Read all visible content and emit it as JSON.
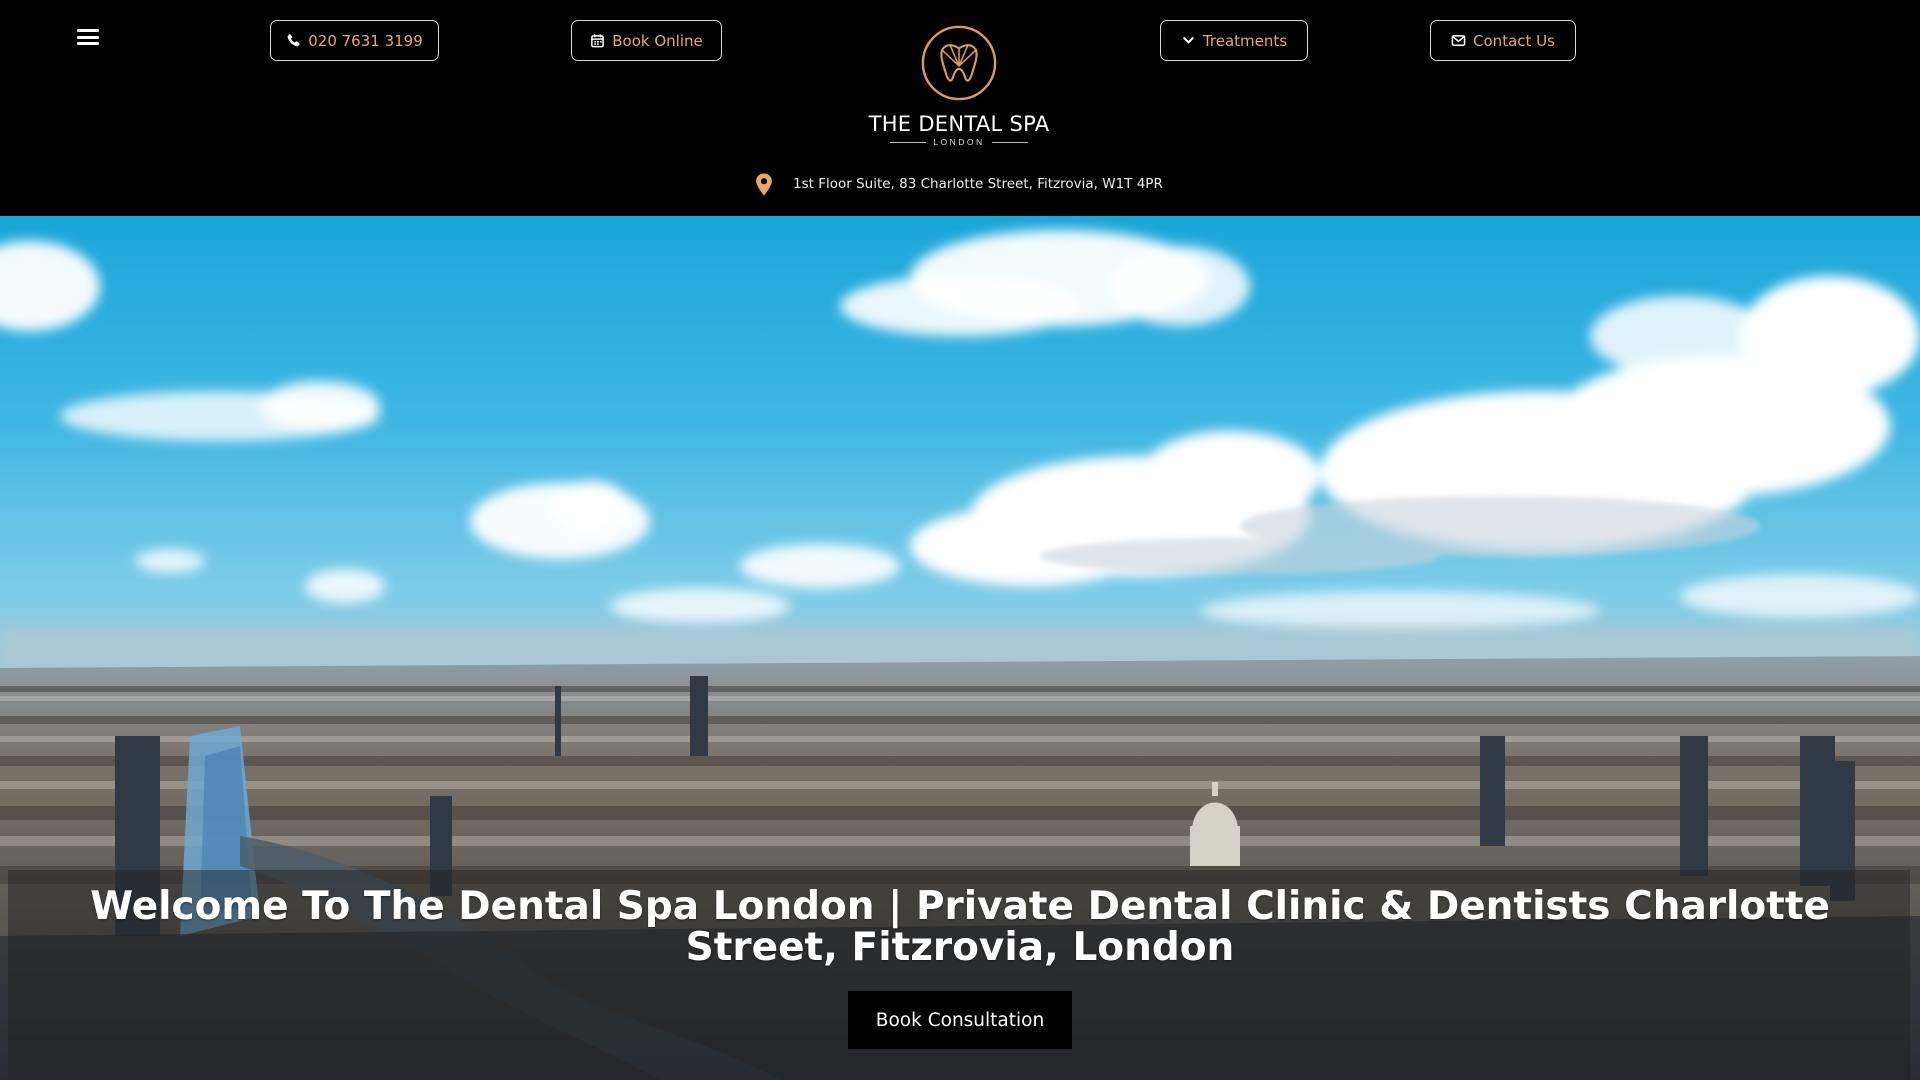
{
  "header": {
    "menu_icon": "hamburger-icon",
    "phone": {
      "label": "020 7631 3199",
      "icon": "phone-icon"
    },
    "book": {
      "label": "Book Online",
      "icon": "calendar-icon"
    },
    "treatments": {
      "label": "Treatments",
      "icon": "chevron-down-icon"
    },
    "contact": {
      "label": "Contact Us",
      "icon": "envelope-icon"
    },
    "logo": {
      "title": "THE DENTAL SPA",
      "subtitle": "LONDON",
      "icon": "tooth-logo-icon"
    },
    "address": {
      "text": "1st Floor Suite, 83 Charlotte Street, Fitzrovia, W1T 4PR",
      "icon": "map-pin-icon"
    }
  },
  "hero": {
    "background": "London skyline aerial view",
    "headline": "Welcome To The Dental Spa London | Private Dental Clinic & Dentists Charlotte Street, Fitzrovia, London",
    "cta_label": "Book Consultation"
  },
  "colors": {
    "accent": "#e8a868",
    "background": "#000000",
    "text": "#ffffff"
  }
}
